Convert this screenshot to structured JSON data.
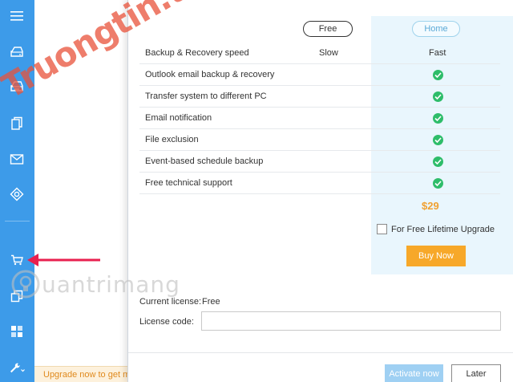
{
  "sidebar": {
    "icons": [
      "menu-icon",
      "backup-disk-icon",
      "restore-icon",
      "clone-icon",
      "email-backup-icon",
      "tools-icon",
      "cart-icon",
      "help-icon",
      "clone-files-icon",
      "apps-icon",
      "wrench-icon"
    ]
  },
  "background": {
    "upgrade_text": "Upgrade now to get m"
  },
  "dialog": {
    "plans": {
      "free_label": "Free",
      "home_label": "Home"
    },
    "features": [
      {
        "label": "Backup & Recovery speed",
        "free": "Slow",
        "home": "Fast"
      },
      {
        "label": "Outlook email backup & recovery",
        "free": "",
        "home": "check"
      },
      {
        "label": "Transfer system to different PC",
        "free": "",
        "home": "check"
      },
      {
        "label": "Email notification",
        "free": "",
        "home": "check"
      },
      {
        "label": "File exclusion",
        "free": "",
        "home": "check"
      },
      {
        "label": "Event-based schedule backup",
        "free": "",
        "home": "check"
      },
      {
        "label": "Free technical support",
        "free": "",
        "home": "check"
      }
    ],
    "price": "$29",
    "lifetime_upgrade_label": "For Free Lifetime Upgrade",
    "lifetime_upgrade_checked": false,
    "buy_now_label": "Buy Now",
    "current_license_label": "Current license:",
    "current_license_value": "Free",
    "license_code_label": "License code:",
    "license_code_value": "",
    "activate_label": "Activate now",
    "later_label": "Later"
  },
  "watermarks": {
    "top": "Truongtin.top",
    "bottom": "uantrimang"
  },
  "colors": {
    "sidebar": "#3d9be9",
    "home_column": "#e9f6fd",
    "check": "#2ebd6a",
    "price": "#f0a030",
    "buy_button": "#f7a829",
    "activate_button": "#9fd0f3",
    "arrow": "#e8204f"
  }
}
